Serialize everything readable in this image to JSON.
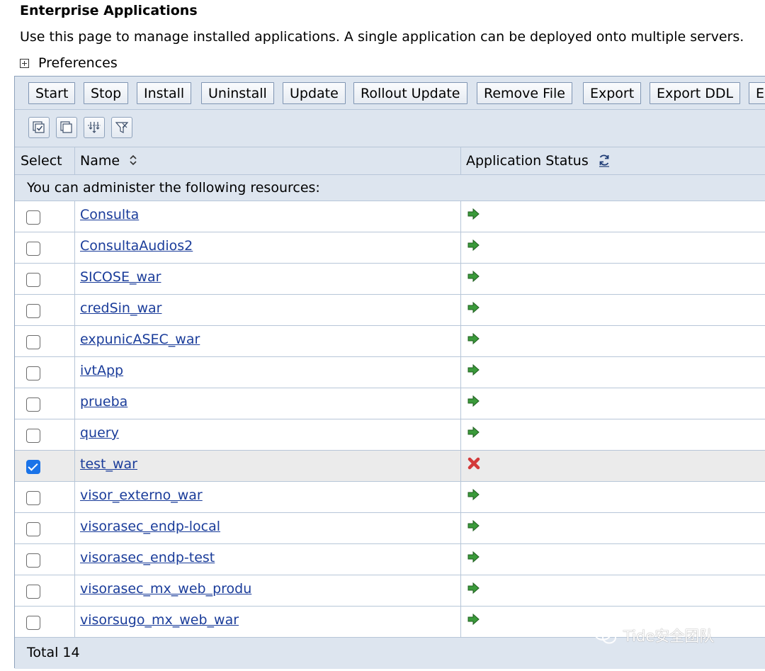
{
  "page": {
    "title": "Enterprise Applications",
    "description": "Use this page to manage installed applications. A single application can be deployed onto multiple servers.",
    "preferences_label": "Preferences"
  },
  "toolbar": {
    "buttons": [
      "Start",
      "Stop",
      "Install",
      "Uninstall",
      "Update",
      "Rollout Update",
      "Remove File",
      "Export",
      "Export DDL",
      "E"
    ]
  },
  "icon_toolbar": {
    "icons": [
      "select-all-icon",
      "deselect-all-icon",
      "expand-filter-icon",
      "clear-filter-icon"
    ]
  },
  "table": {
    "headers": {
      "select": "Select",
      "name": "Name",
      "status": "Application Status"
    },
    "resources_note": "You can administer the following resources:",
    "rows": [
      {
        "name": "Consulta",
        "checked": false,
        "status": "started"
      },
      {
        "name": "ConsultaAudios2",
        "checked": false,
        "status": "started"
      },
      {
        "name": "SICOSE_war",
        "checked": false,
        "status": "started"
      },
      {
        "name": "credSin_war",
        "checked": false,
        "status": "started"
      },
      {
        "name": "expunicASEC_war",
        "checked": false,
        "status": "started"
      },
      {
        "name": "ivtApp",
        "checked": false,
        "status": "started"
      },
      {
        "name": "prueba",
        "checked": false,
        "status": "started"
      },
      {
        "name": "query",
        "checked": false,
        "status": "started"
      },
      {
        "name": "test_war",
        "checked": true,
        "status": "stopped"
      },
      {
        "name": "visor_externo_war",
        "checked": false,
        "status": "started"
      },
      {
        "name": "visorasec_endp-local",
        "checked": false,
        "status": "started"
      },
      {
        "name": "visorasec_endp-test",
        "checked": false,
        "status": "started"
      },
      {
        "name": "visorasec_mx_web_produ",
        "checked": false,
        "status": "started"
      },
      {
        "name": "visorsugo_mx_web_war",
        "checked": false,
        "status": "started"
      }
    ],
    "total": "Total 14"
  },
  "colors": {
    "panel_bg": "#dde5ef",
    "link": "#1a3c9a",
    "started": "#3a9a3a",
    "stopped": "#d33a3a",
    "checkbox_checked": "#1a73e8"
  },
  "watermark": {
    "text": "Tide安全团队"
  }
}
